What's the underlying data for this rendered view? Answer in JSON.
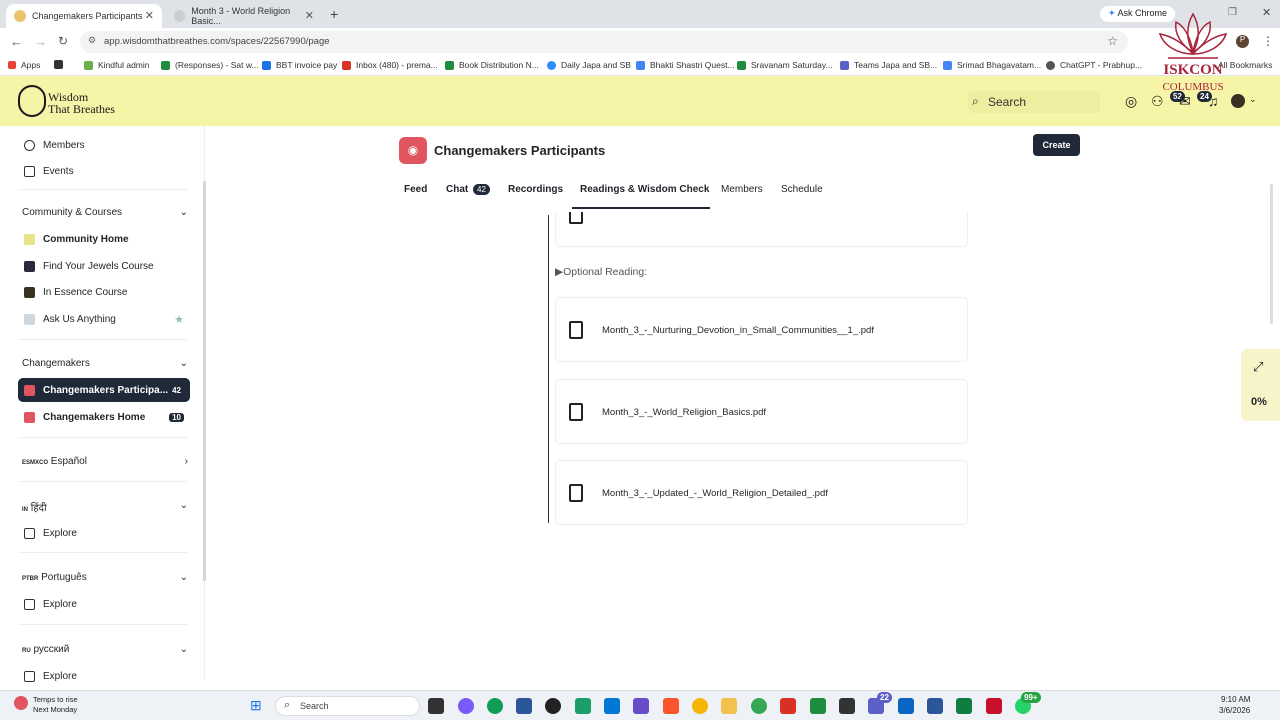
{
  "browser": {
    "tabs": [
      {
        "label": "Changemakers Participants",
        "active": true
      },
      {
        "label": "Month 3 - World Religion Basic..."
      }
    ],
    "new_tab": "+",
    "ask_chrome": "Ask Chrome",
    "url": "app.wisdomthatbreathes.com/spaces/22567990/page",
    "bookmarks": [
      "Apps",
      "Kindful admin",
      "(Responses) - Sat w...",
      "BBT invoice pay",
      "Inbox (480) - prema...",
      "Book Distribution N...",
      "Daily Japa and SB",
      "Bhakti Shastri Quest...",
      "Sravanam Saturday...",
      "Teams Japa and SB...",
      "Srimad Bhagavatam...",
      "ChatGPT - Prabhup...",
      "All Bookmarks"
    ]
  },
  "app": {
    "logo_line1": "Wisdom",
    "logo_line2": "That Breathes",
    "search_placeholder": "Search",
    "badge_a": "52",
    "badge_b": "24",
    "create_label": "Create"
  },
  "sidebar": {
    "top_items": [
      {
        "label": "Members",
        "icon": "members-icon"
      },
      {
        "label": "Events",
        "icon": "calendar-icon"
      }
    ],
    "community_head": "Community & Courses",
    "community_items": [
      {
        "label": "Community Home"
      },
      {
        "label": "Find Your Jewels Course"
      },
      {
        "label": "In Essence Course"
      },
      {
        "label": "Ask Us Anything"
      }
    ],
    "changemakers_head": "Changemakers",
    "changemakers_items": [
      {
        "label": "Changemakers Participa...",
        "count": "42"
      },
      {
        "label": "Changemakers Home",
        "count": "10"
      }
    ],
    "espanol_prefix": "ESMXCO",
    "espanol_label": "Español",
    "hindi_prefix": "IN",
    "hindi_label": "हिंदी",
    "portugues_prefix": "PTBR",
    "portugues_label": "Português",
    "russian_prefix": "RU",
    "russian_label": "русский",
    "explore_label": "Explore"
  },
  "space": {
    "title": "Changemakers Participants",
    "tabs": [
      "Feed",
      "Chat",
      "Recordings",
      "Readings & Wisdom Check",
      "Members",
      "Schedule"
    ],
    "chat_count": "42",
    "optional_heading": "▶Optional Reading:",
    "files": [
      "Month_3_-_Nurturing_Devotion_in_Small_Communities__1_.pdf",
      "Month_3_-_World_Religion_Basics.pdf",
      "Month_3_-_Updated_-_World_Religion_Detailed_.pdf"
    ]
  },
  "widget": {
    "percent": "0%"
  },
  "watermark": {
    "line1": "ISKCON",
    "line2": "COLUMBUS"
  },
  "taskbar": {
    "weather_line1": "Temps to rise",
    "weather_line2": "Next Monday",
    "search_label": "Search",
    "time": "9:10 AM",
    "date": "3/6/2026",
    "teams_badge": "22",
    "whatsapp_badge": "99+"
  }
}
